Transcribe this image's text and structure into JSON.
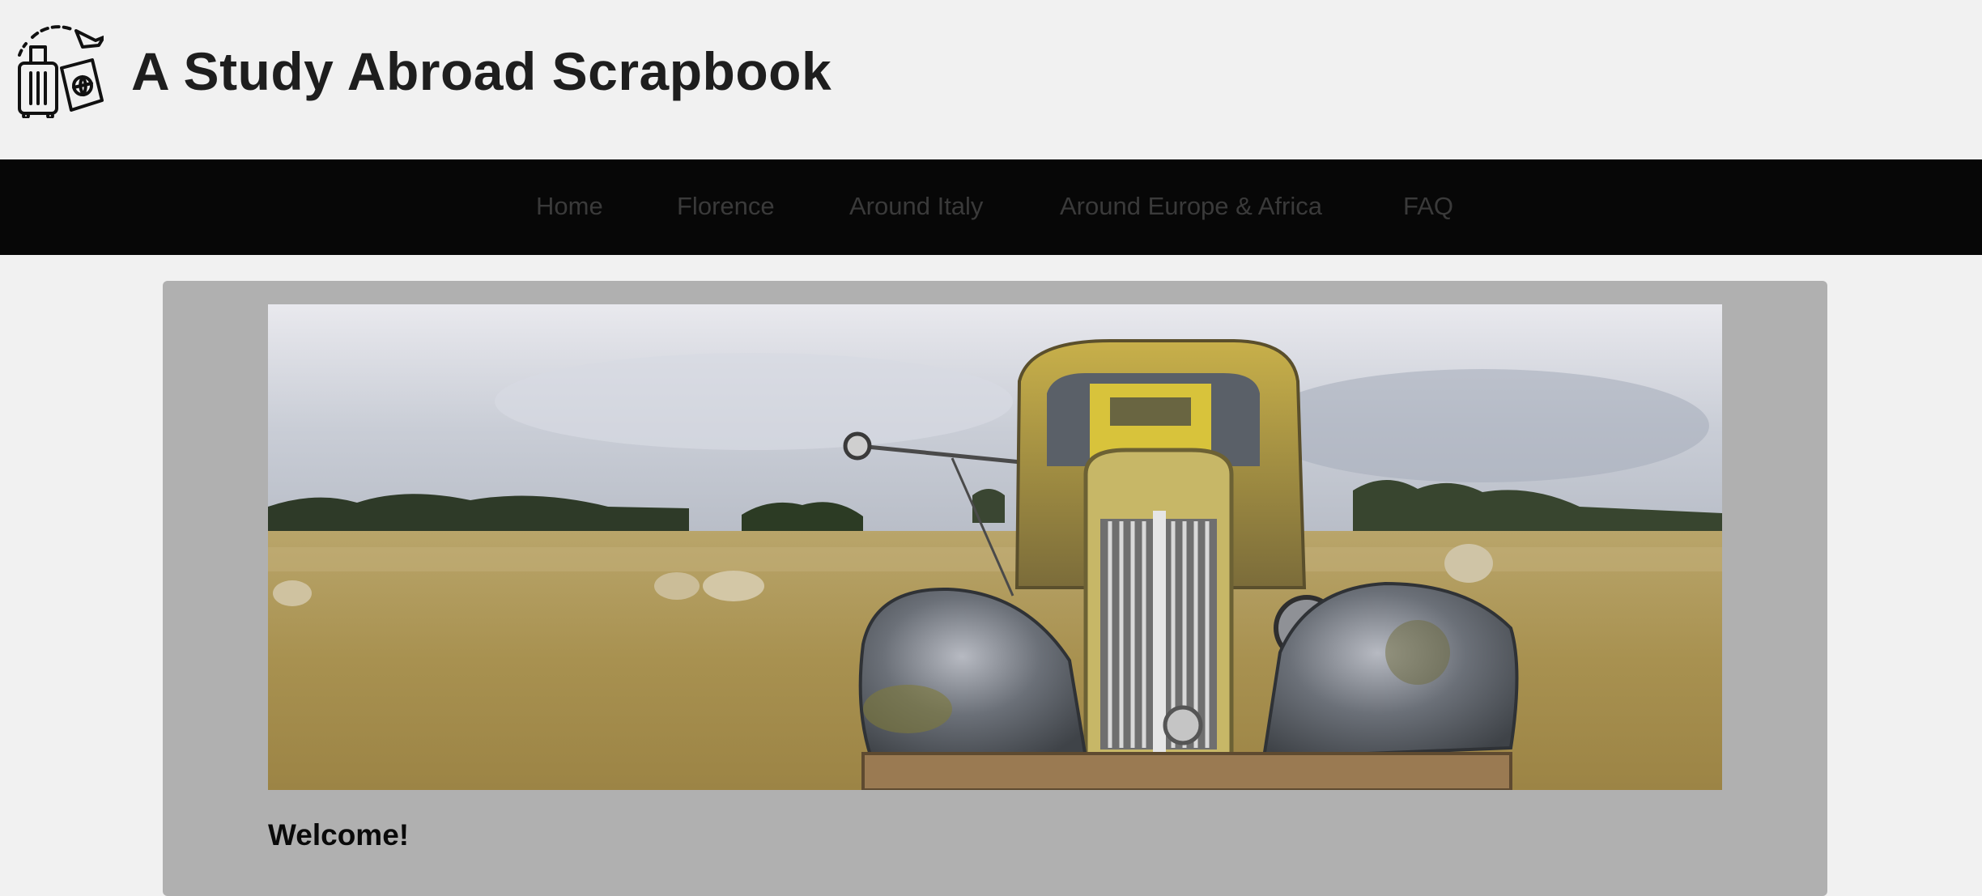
{
  "header": {
    "title": "A Study Abroad Scrapbook",
    "logo_icon": "luggage-passport-icon"
  },
  "nav": {
    "items": [
      {
        "label": "Home"
      },
      {
        "label": "Florence"
      },
      {
        "label": "Around Italy"
      },
      {
        "label": "Around Europe & Africa"
      },
      {
        "label": "FAQ"
      }
    ]
  },
  "main": {
    "hero_image": "abandoned-rusty-truck-in-field",
    "welcome_heading": "Welcome!"
  },
  "colors": {
    "page_background": "#f1f1f1",
    "navbar_background": "#070707",
    "nav_text": "#3a3a3a",
    "card_background": "#b0b0b0",
    "title_text": "#1e1e1e"
  }
}
